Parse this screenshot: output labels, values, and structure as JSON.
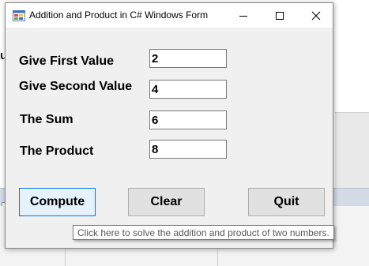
{
  "window": {
    "title": "Addition and Product in C# Windows Form",
    "icon": "winforms-app-icon"
  },
  "background": {
    "partial_text": "u"
  },
  "form": {
    "first_label": "Give First Value",
    "first_value": "2",
    "second_label": "Give Second Value",
    "second_value": "4",
    "sum_label": "The Sum",
    "sum_value": "6",
    "product_label": "The Product",
    "product_value": "8"
  },
  "buttons": {
    "compute": "Compute",
    "clear": "Clear",
    "quit": "Quit"
  },
  "tooltip": {
    "text": "Click here to solve the addition and product of two numbers."
  },
  "colors": {
    "focus_border": "#0078d7",
    "button_face": "#e1e1e1",
    "form_background": "#f0f0f0"
  }
}
